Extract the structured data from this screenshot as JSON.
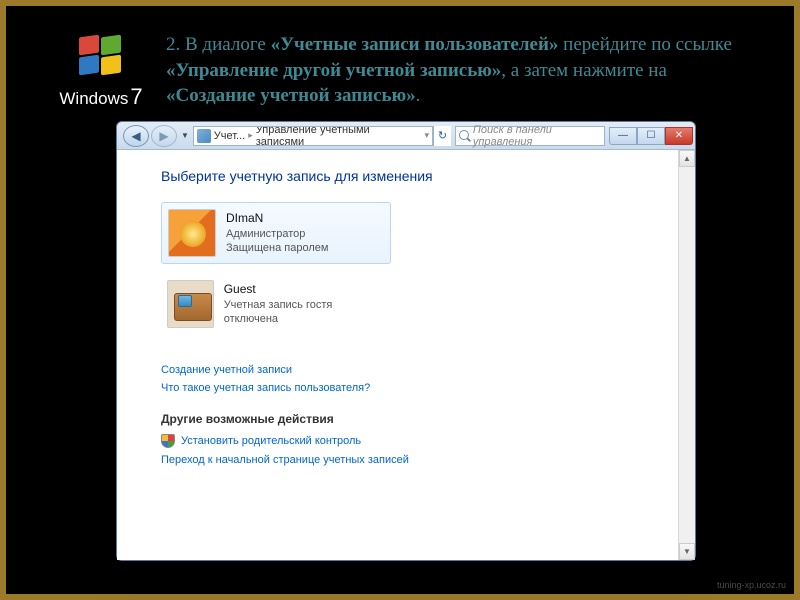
{
  "logo_text_prefix": "Windows",
  "logo_text_suffix": "7",
  "instruction_html": "2. В диалоге <b>«Учетные записи пользователей»</b> перейдите по ссылке <b>«Управление другой учетной записью»</b>, а затем нажмите на <b>«Создание учетной записью»</b>.",
  "titlebar": {
    "breadcrumb_1": "Учет...",
    "breadcrumb_2": "Управление учетными записями",
    "search_placeholder": "Поиск в панели управления"
  },
  "page": {
    "heading": "Выберите учетную запись для изменения",
    "accounts": [
      {
        "name": "DImaN",
        "role": "Администратор",
        "status": "Защищена паролем"
      },
      {
        "name": "Guest",
        "role": "",
        "status": "Учетная запись гостя отключена"
      }
    ],
    "create_link": "Создание учетной записи",
    "what_is_link": "Что такое учетная запись пользователя?",
    "other_section_title": "Другие возможные действия",
    "parental_link": "Установить родительский контроль",
    "mainpage_link": "Переход к начальной странице учетных записей"
  },
  "watermark": "tuning-xp.ucoz.ru"
}
